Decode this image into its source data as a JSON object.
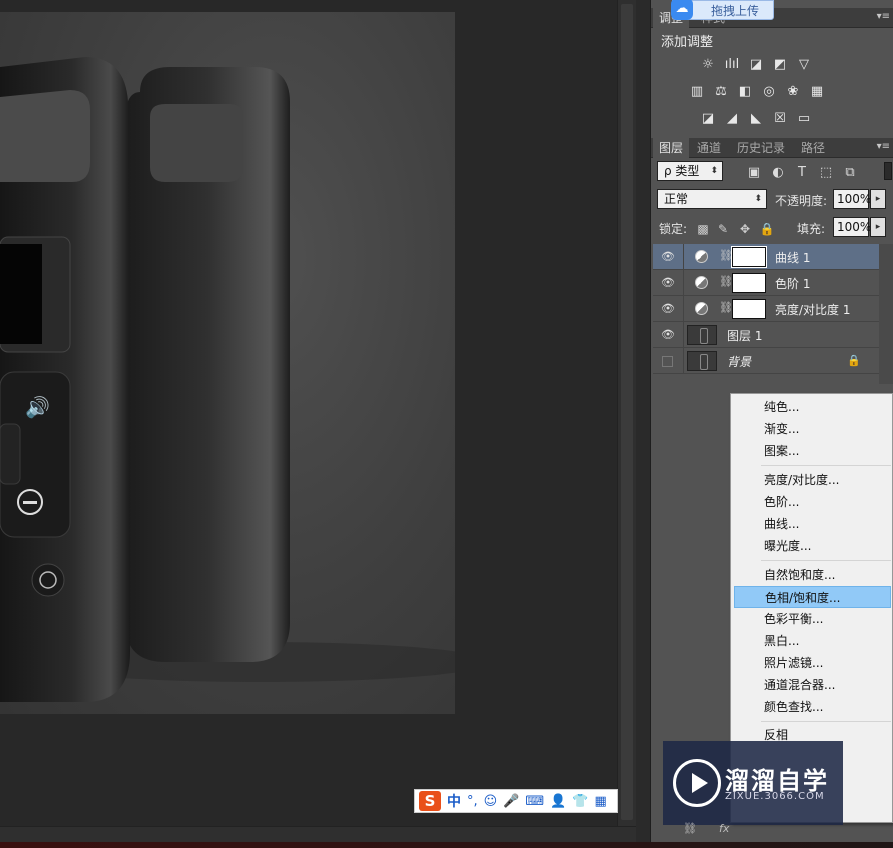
{
  "upload_tooltip": {
    "text": "拖拽上传",
    "icon": "cloud-upload-icon"
  },
  "adjustments_panel": {
    "tabs": [
      "调整",
      "样式"
    ],
    "title": "添加调整"
  },
  "layers_panel": {
    "tabs": [
      "图层",
      "通道",
      "历史记录",
      "路径"
    ],
    "filter_kind": "ρ 类型",
    "blend_mode": "正常",
    "opacity_label": "不透明度:",
    "opacity_value": "100%",
    "lock_label": "锁定:",
    "fill_label": "填充:",
    "fill_value": "100%",
    "layers": [
      {
        "name": "曲线 1",
        "visible": true,
        "selected": true,
        "kind": "adjustment"
      },
      {
        "name": "色阶 1",
        "visible": true,
        "selected": false,
        "kind": "adjustment"
      },
      {
        "name": "亮度/对比度 1",
        "visible": true,
        "selected": false,
        "kind": "adjustment"
      },
      {
        "name": "图层 1",
        "visible": true,
        "selected": false,
        "kind": "pixel"
      },
      {
        "name": "背景",
        "visible": false,
        "selected": false,
        "kind": "pixel",
        "locked": true
      }
    ]
  },
  "context_menu": {
    "items": [
      "纯色...",
      "渐变...",
      "图案...",
      "亮度/对比度...",
      "色阶...",
      "曲线...",
      "曝光度...",
      "自然饱和度...",
      "色相/饱和度...",
      "色彩平衡...",
      "黑白...",
      "照片滤镜...",
      "通道混合器...",
      "颜色查找...",
      "反相"
    ],
    "highlighted": "色相/饱和度..."
  },
  "ime_bar": {
    "logo": "S",
    "mode": "中",
    "punct": "°,"
  },
  "watermark": {
    "title": "溜溜自学",
    "url": "ZIXUE.3066.COM"
  },
  "colors": {
    "panel_bg": "#535353",
    "selected_layer": "#5e6f87",
    "menu_highlight": "#91c9f7"
  }
}
